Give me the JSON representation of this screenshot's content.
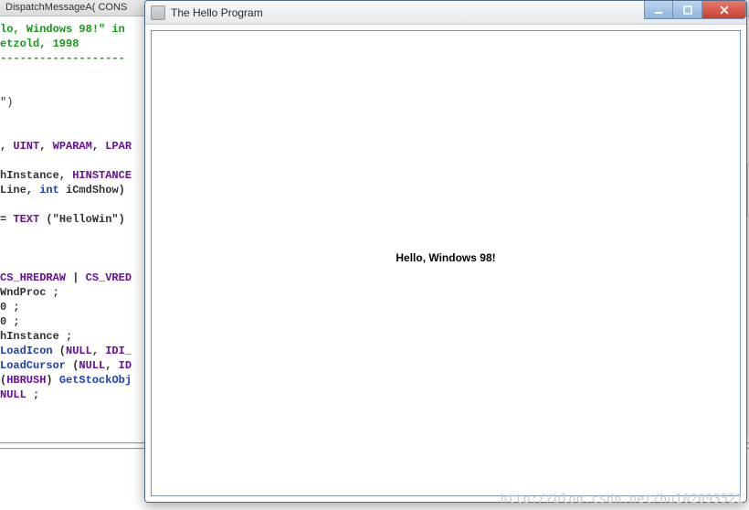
{
  "editor": {
    "topbar_text": "DispatchMessageA( CONS",
    "code_lines": [
      {
        "kind": "c",
        "text": "lo, Windows 98!\" in"
      },
      {
        "kind": "c",
        "text": "etzold, 1998"
      },
      {
        "kind": "c",
        "text": "-------------------"
      },
      {
        "kind": "p",
        "text": ""
      },
      {
        "kind": "p",
        "text": ""
      },
      {
        "kind": "p",
        "text": "\")"
      },
      {
        "kind": "p",
        "text": ""
      },
      {
        "kind": "p",
        "text": ""
      },
      {
        "kind": "mix",
        "parts": [
          {
            "cls": "plain bold",
            "t": ", "
          },
          {
            "cls": "tok-t",
            "t": "UINT"
          },
          {
            "cls": "plain bold",
            "t": ", "
          },
          {
            "cls": "tok-t",
            "t": "WPARAM"
          },
          {
            "cls": "plain bold",
            "t": ", "
          },
          {
            "cls": "tok-t",
            "t": "LPAR"
          }
        ]
      },
      {
        "kind": "p",
        "text": ""
      },
      {
        "kind": "mix",
        "parts": [
          {
            "cls": "plain bold",
            "t": "hInstance, "
          },
          {
            "cls": "tok-t",
            "t": "HINSTANCE"
          }
        ]
      },
      {
        "kind": "mix",
        "parts": [
          {
            "cls": "plain bold",
            "t": "Line, "
          },
          {
            "cls": "tok-k",
            "t": "int"
          },
          {
            "cls": "plain bold",
            "t": " iCmdShow)"
          }
        ]
      },
      {
        "kind": "p",
        "text": ""
      },
      {
        "kind": "mix",
        "parts": [
          {
            "cls": "plain bold",
            "t": "= "
          },
          {
            "cls": "tok-m",
            "t": "TEXT"
          },
          {
            "cls": "plain bold",
            "t": " (\"HelloWin\")"
          }
        ]
      },
      {
        "kind": "p",
        "text": ""
      },
      {
        "kind": "p",
        "text": ""
      },
      {
        "kind": "p",
        "text": ""
      },
      {
        "kind": "mix",
        "parts": [
          {
            "cls": "tok-m",
            "t": "CS_HREDRAW"
          },
          {
            "cls": "plain bold",
            "t": " | "
          },
          {
            "cls": "tok-m",
            "t": "CS_VRED"
          }
        ]
      },
      {
        "kind": "p",
        "text": "WndProc ;",
        "bold": true
      },
      {
        "kind": "p",
        "text": "0 ;",
        "bold": true
      },
      {
        "kind": "p",
        "text": "0 ;",
        "bold": true
      },
      {
        "kind": "p",
        "text": "hInstance ;",
        "bold": true
      },
      {
        "kind": "mix",
        "parts": [
          {
            "cls": "tok-f",
            "t": "LoadIcon"
          },
          {
            "cls": "plain bold",
            "t": " ("
          },
          {
            "cls": "tok-m",
            "t": "NULL"
          },
          {
            "cls": "plain bold",
            "t": ", "
          },
          {
            "cls": "tok-m",
            "t": "IDI_"
          }
        ]
      },
      {
        "kind": "mix",
        "parts": [
          {
            "cls": "tok-f",
            "t": "LoadCursor"
          },
          {
            "cls": "plain bold",
            "t": " ("
          },
          {
            "cls": "tok-m",
            "t": "NULL"
          },
          {
            "cls": "plain bold",
            "t": ", "
          },
          {
            "cls": "tok-m",
            "t": "ID"
          }
        ]
      },
      {
        "kind": "mix",
        "parts": [
          {
            "cls": "plain bold",
            "t": "("
          },
          {
            "cls": "tok-t",
            "t": "HBRUSH"
          },
          {
            "cls": "plain bold",
            "t": ") "
          },
          {
            "cls": "tok-f",
            "t": "GetStockObj"
          }
        ]
      },
      {
        "kind": "mix",
        "parts": [
          {
            "cls": "tok-m",
            "t": "NULL"
          },
          {
            "cls": "plain bold",
            "t": " ;"
          }
        ]
      }
    ]
  },
  "window": {
    "title": "The Hello Program",
    "client_text": "Hello, Windows 98!",
    "buttons": {
      "min_tip": "Minimize",
      "max_tip": "Maximize",
      "close_tip": "Close"
    }
  },
  "watermark": "http://blog.csdn.net/hu102093521"
}
